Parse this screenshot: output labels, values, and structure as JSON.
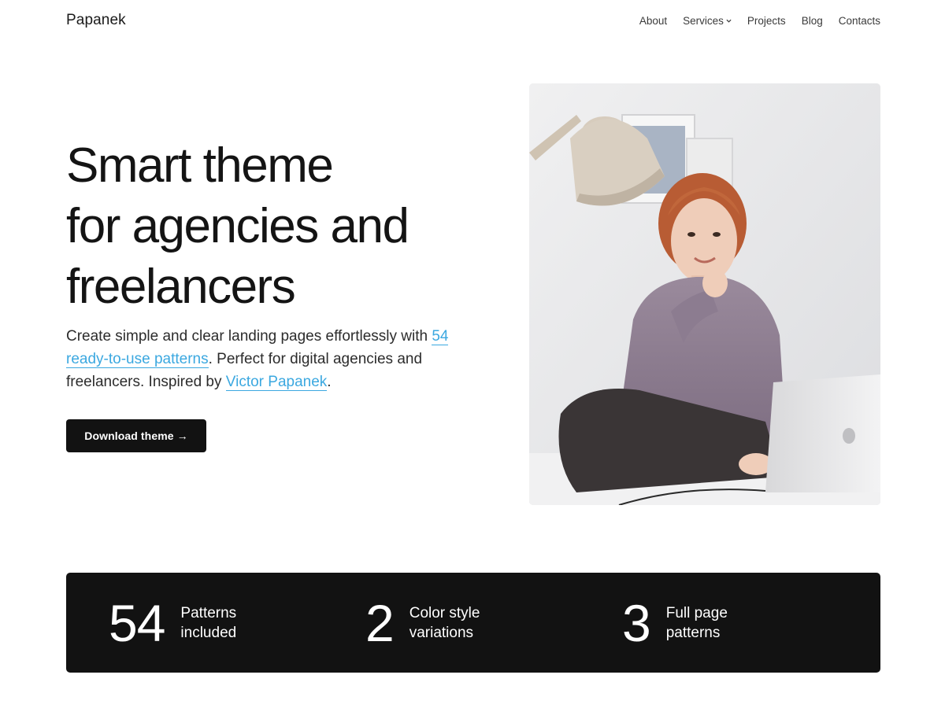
{
  "header": {
    "logo": "Papanek",
    "nav": [
      {
        "label": "About"
      },
      {
        "label": "Services"
      },
      {
        "label": "Projects"
      },
      {
        "label": "Blog"
      },
      {
        "label": "Contacts"
      }
    ]
  },
  "hero": {
    "title_lines": [
      "Smart theme",
      "for agencies and",
      "freelancers"
    ],
    "description": {
      "part1": "Create simple and clear landing pages effortlessly with ",
      "link1": "54 ready-to-use patterns",
      "part2": ". Perfect for digital agencies and freelancers. Inspired by ",
      "link2": "Victor Papanek",
      "part3": "."
    },
    "cta_label": "Download theme →",
    "link_color": "#3ba8e0"
  },
  "stats": [
    {
      "number": "54",
      "label": "Patterns included"
    },
    {
      "number": "2",
      "label": "Color style variations"
    },
    {
      "number": "3",
      "label": "Full page patterns"
    }
  ],
  "icons": {
    "services_dropdown": "chevron-down-icon"
  },
  "colors": {
    "dark": "#121212",
    "accent": "#3ba8e0"
  }
}
